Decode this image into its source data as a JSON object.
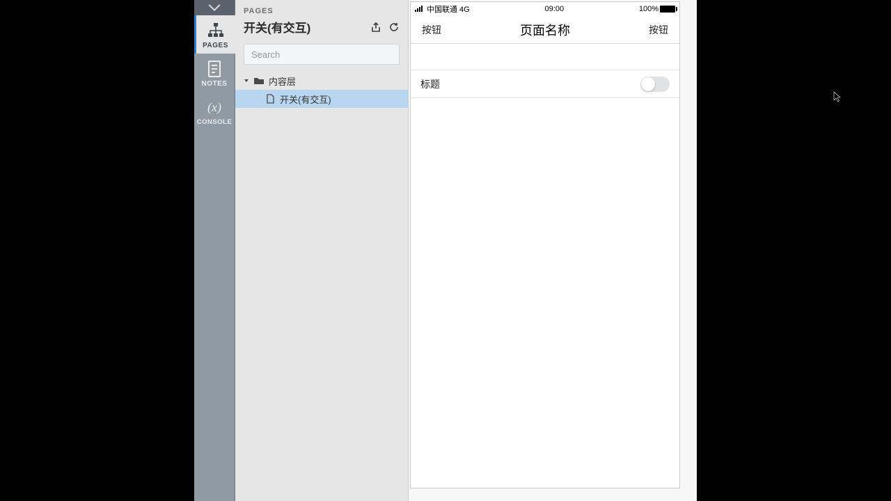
{
  "rail": {
    "items": [
      {
        "key": "pages",
        "label": "PAGES",
        "active": true
      },
      {
        "key": "notes",
        "label": "NOTES",
        "active": false
      },
      {
        "key": "console",
        "label": "CONSOLE",
        "active": false,
        "iconText": "(x)"
      }
    ]
  },
  "panel": {
    "section_label": "PAGES",
    "current_page": "开关(有交互)",
    "search_placeholder": "Search",
    "tree": {
      "folder": {
        "label": "内容层"
      },
      "page": {
        "label": "开关(有交互)",
        "selected": true
      }
    }
  },
  "preview": {
    "statusbar": {
      "carrier": "中国联通 4G",
      "time": "09:00",
      "battery": "100%"
    },
    "nav": {
      "left": "按钮",
      "title": "页面名称",
      "right": "按钮"
    },
    "cell": {
      "label": "标题",
      "switch_on": false
    }
  }
}
